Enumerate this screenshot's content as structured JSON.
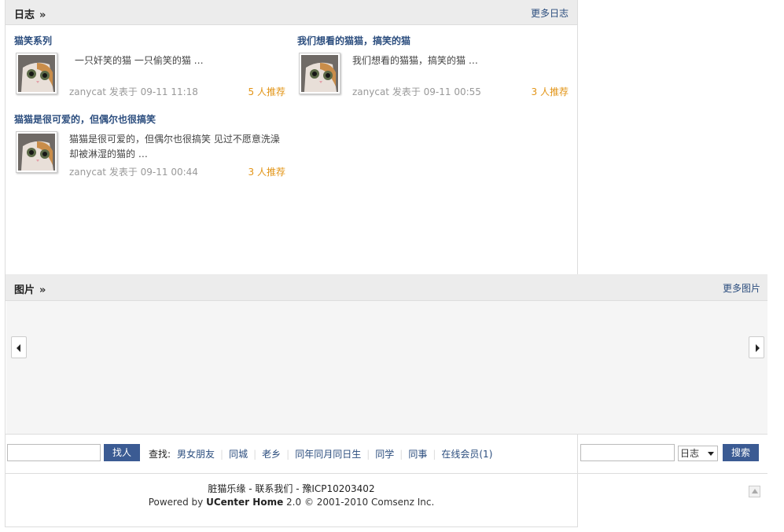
{
  "blog": {
    "title": "日志",
    "more_link": "更多日志",
    "entries": [
      {
        "title": "猫笑系列",
        "excerpt": "一只奸笑的猫 一只偷笑的猫 …",
        "meta": "zanycat 发表于 09-11 11:18",
        "recommend": "5 人推荐"
      },
      {
        "title": "我们想看的猫猫，搞笑的猫",
        "excerpt": "我们想看的猫猫，搞笑的猫 …",
        "meta": "zanycat 发表于 09-11 00:55",
        "recommend": "3 人推荐"
      },
      {
        "title": "猫猫是很可爱的，但偶尔也很搞笑",
        "excerpt": "猫猫是很可爱的，但偶尔也很搞笑 见过不愿意洗澡却被淋湿的猫的 …",
        "meta": "zanycat 发表于 09-11 00:44",
        "recommend": "3 人推荐"
      }
    ]
  },
  "photo": {
    "title": "图片",
    "more_link": "更多图片"
  },
  "find": {
    "input_value": "",
    "button": "找人",
    "label": "查找:",
    "links": [
      "男女朋友",
      "同城",
      "老乡",
      "同年同月同日生",
      "同学",
      "同事",
      "在线会员(1)"
    ]
  },
  "search": {
    "input_value": "",
    "select_value": "日志",
    "button": "搜索"
  },
  "footer": {
    "line1": "脏猫乐缘 - 联系我们 - 豫ICP10203402",
    "powered_prefix": "Powered by",
    "powered_product": "UCenter Home",
    "powered_suffix": "2.0 © 2001-2010 Comsenz Inc."
  },
  "colors": {
    "link": "#2b4d7e",
    "recommend": "#e29416",
    "button": "#3b5b93",
    "header_bg": "#ececec"
  },
  "icons": [
    "double-chevron-right-icon",
    "arrow-left-icon",
    "arrow-right-icon",
    "dropdown-arrow-icon",
    "back-to-top-icon"
  ]
}
